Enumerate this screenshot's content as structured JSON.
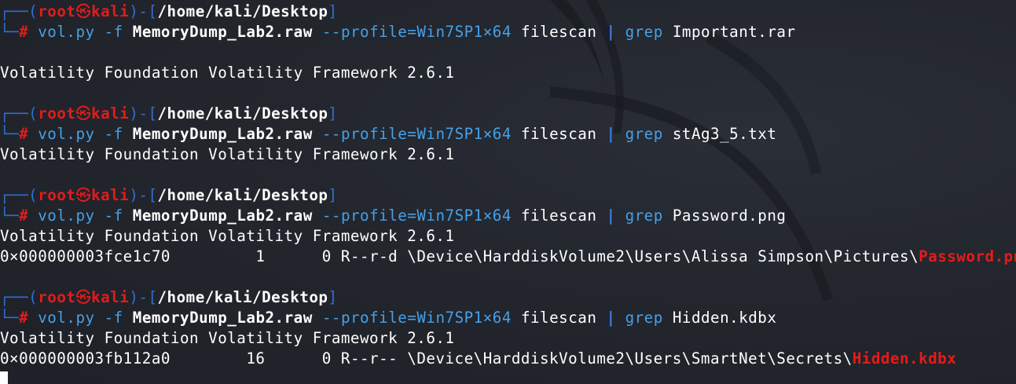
{
  "colors": {
    "background": "#23262d",
    "prompt_frame": "#2f6fd6",
    "prompt_user": "#e51b1b",
    "command": "#45a0e8",
    "highlight": "#e51b1b",
    "text": "#ffffff"
  },
  "prompt": {
    "frame_top": "┌──(",
    "user": "root",
    "skull_icon": "㉿",
    "host": "kali",
    "frame_mid": ")-[",
    "cwd": "/home/kali/Desktop",
    "frame_end": "]",
    "frame_bottom": "└─",
    "symbol": "#"
  },
  "command": {
    "program": "vol.py",
    "flag": "-f",
    "dump_file": "MemoryDump_Lab2.raw",
    "profile": "--profile=Win7SP1×64",
    "plugin": "filescan",
    "pipe": "|",
    "grep": "grep"
  },
  "banner": "Volatility Foundation Volatility Framework 2.6.1",
  "sessions": [
    {
      "search": "Important.rar",
      "results": []
    },
    {
      "search": "stAg3_5.txt",
      "results": []
    },
    {
      "search": "Password.png",
      "results": [
        {
          "offset": "0×000000003fce1c70",
          "ptr": "1",
          "hnd": "0",
          "access": "R--r-d",
          "path": "\\Device\\HarddiskVolume2\\Users\\Alissa Simpson\\Pictures\\",
          "filename": "Password.png"
        }
      ]
    },
    {
      "search": "Hidden.kdbx",
      "results": [
        {
          "offset": "0×000000003fb112a0",
          "ptr": "16",
          "hnd": "0",
          "access": "R--r--",
          "path": "\\Device\\HarddiskVolume2\\Users\\SmartNet\\Secrets\\",
          "filename": "Hidden.kdbx"
        }
      ]
    }
  ]
}
